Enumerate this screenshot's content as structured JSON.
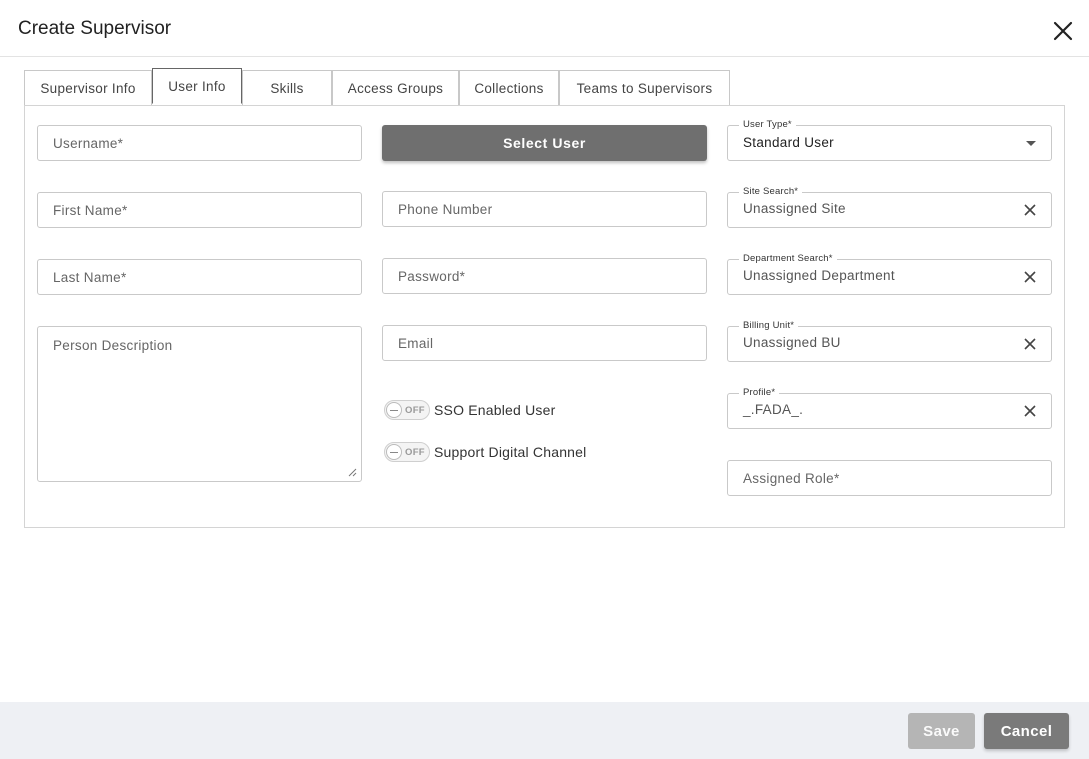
{
  "dialog": {
    "title": "Create Supervisor"
  },
  "tabs": [
    {
      "label": "Supervisor Info",
      "active": false
    },
    {
      "label": "User Info",
      "active": true
    },
    {
      "label": "Skills",
      "active": false
    },
    {
      "label": "Access Groups",
      "active": false
    },
    {
      "label": "Collections",
      "active": false
    },
    {
      "label": "Teams to Supervisors",
      "active": false
    }
  ],
  "form": {
    "username": {
      "placeholder": "Username*"
    },
    "first_name": {
      "placeholder": "First Name*"
    },
    "last_name": {
      "placeholder": "Last Name*"
    },
    "person_description": {
      "placeholder": "Person Description"
    },
    "select_user_label": "Select User",
    "phone_number": {
      "placeholder": "Phone Number"
    },
    "password": {
      "placeholder": "Password*"
    },
    "email": {
      "placeholder": "Email"
    },
    "sso_toggle": {
      "label": "SSO Enabled User",
      "state": "OFF"
    },
    "digital_toggle": {
      "label": "Support Digital Channel",
      "state": "OFF"
    },
    "user_type": {
      "label": "User Type*",
      "value": "Standard User"
    },
    "site_search": {
      "label": "Site Search*",
      "value": "Unassigned Site"
    },
    "department_search": {
      "label": "Department Search*",
      "value": "Unassigned Department"
    },
    "billing_unit": {
      "label": "Billing Unit*",
      "value": "Unassigned BU"
    },
    "profile": {
      "label": "Profile*",
      "value": "_.FADA_."
    },
    "assigned_role": {
      "placeholder": "Assigned Role*"
    }
  },
  "footer": {
    "save_label": "Save",
    "cancel_label": "Cancel"
  },
  "icons": {
    "close": "close-icon",
    "clear": "clear-icon",
    "dropdown": "chevron-down-icon"
  }
}
